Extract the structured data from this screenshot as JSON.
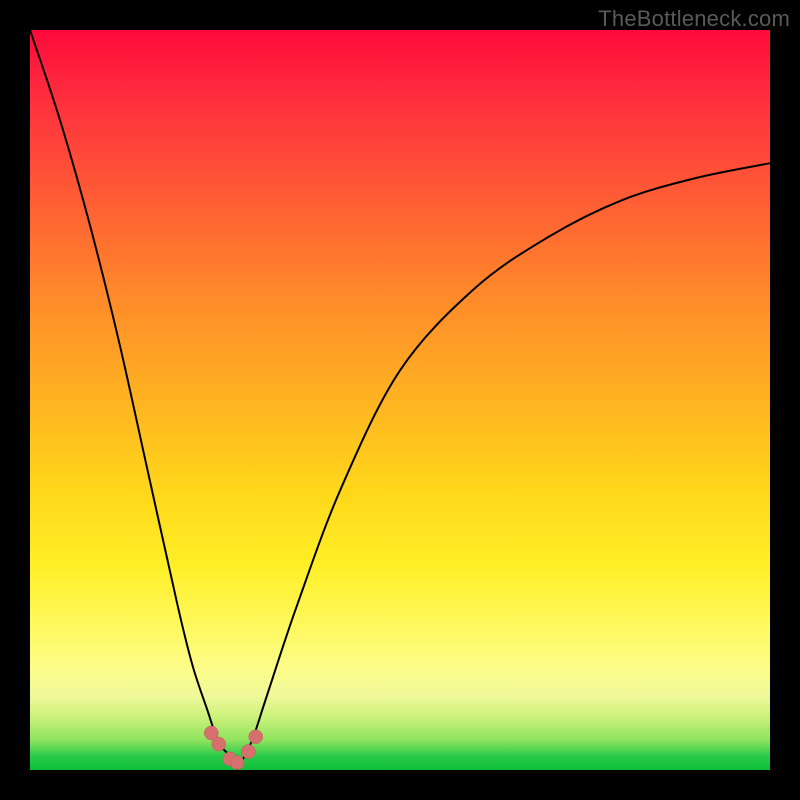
{
  "watermark": "TheBottleneck.com",
  "colors": {
    "background": "#000000",
    "gradient_top": "#ff0a3a",
    "gradient_bottom": "#0cbf3a",
    "curve_stroke": "#000000",
    "marker_fill": "#d6706e"
  },
  "chart_data": {
    "type": "line",
    "title": "",
    "xlabel": "",
    "ylabel": "",
    "xlim": [
      0,
      100
    ],
    "ylim": [
      0,
      100
    ],
    "grid": false,
    "legend": false,
    "note": "Two curves forming a V/valley shape on a red-to-green vertical gradient; curve values represent height above the green bottom (y=0) as approximate percentage of plot height at sampled x positions.",
    "series": [
      {
        "name": "left-branch",
        "x": [
          0,
          4,
          8,
          12,
          16,
          20,
          22,
          24,
          25,
          26,
          27,
          28
        ],
        "values": [
          100,
          88,
          74,
          58,
          40,
          22,
          14,
          8,
          5,
          3,
          2,
          1
        ]
      },
      {
        "name": "right-branch",
        "x": [
          28,
          30,
          32,
          36,
          42,
          50,
          60,
          70,
          80,
          90,
          100
        ],
        "values": [
          0,
          4,
          10,
          22,
          38,
          54,
          65,
          72,
          77,
          80,
          82
        ]
      }
    ],
    "markers": {
      "name": "valley-points",
      "x": [
        24.5,
        25.5,
        27.0,
        28.0,
        29.5,
        30.5
      ],
      "values": [
        5.0,
        3.5,
        1.5,
        1.0,
        2.5,
        4.5
      ]
    }
  }
}
